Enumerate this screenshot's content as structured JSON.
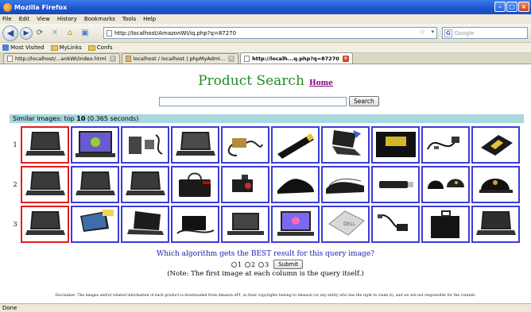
{
  "window": {
    "title": "Mozilla Firefox"
  },
  "menu": [
    "File",
    "Edit",
    "View",
    "History",
    "Bookmarks",
    "Tools",
    "Help"
  ],
  "nav": {
    "url": "http://localhost/AmazonWI/iq.php?q=87270",
    "search_placeholder": "Google"
  },
  "bookmarks": [
    "Most Visited",
    "MyLinks",
    "Confs"
  ],
  "tabs": [
    {
      "label": "http://localhost/...ankWI/index.html",
      "active": false
    },
    {
      "label": "localhost / localhost | phpMyAdmi...",
      "active": false
    },
    {
      "label": "http://localh...q.php?q=87270",
      "active": true
    }
  ],
  "page": {
    "title": "Product Search",
    "home_link": "Home",
    "search_button": "Search",
    "results_header_prefix": "Similar images: top ",
    "results_header_count": "10",
    "results_header_time": " (0.365 seconds)"
  },
  "results": {
    "rows": [
      {
        "label": "1",
        "items": [
          "laptop-black",
          "laptop-lit",
          "laptop-accessories",
          "laptop-black-open",
          "power-adapter",
          "battery-stick",
          "laptop-open-screen",
          "battery-pack",
          "cables",
          "cd-drive"
        ]
      },
      {
        "label": "2",
        "items": [
          "laptop-black",
          "laptop-black",
          "laptop-black",
          "laptop-bag",
          "projector",
          "shoe",
          "shoes-pair",
          "usb-stick",
          "caps",
          "cap-black"
        ]
      },
      {
        "label": "3",
        "items": [
          "laptop-black",
          "laptop-offer",
          "laptop-black-side",
          "adapter-kit",
          "laptop-black-flat",
          "laptop-lit-2",
          "laptop-silver",
          "adapter-cable",
          "briefcase",
          "laptop-black-2"
        ]
      }
    ],
    "query_column": 0
  },
  "survey": {
    "question": "Which algorithm gets the BEST result for this query image?",
    "options": [
      "1",
      "2",
      "3"
    ],
    "submit_label": "Submit",
    "note": "(Note: The first image at each column is the query itself.)"
  },
  "disclaimer": "Disclaimer: The images and/or related information of each product is downloaded from Amazon API, so their copyrights belong to Amazon (or any entity who has the right to claim it), and we are not responsible for the content.",
  "status": "Done",
  "colors": {
    "query_border": "#e01f1f",
    "result_border": "#3b3bd9",
    "header_bg": "#a7d8de",
    "title": "#228b22"
  }
}
